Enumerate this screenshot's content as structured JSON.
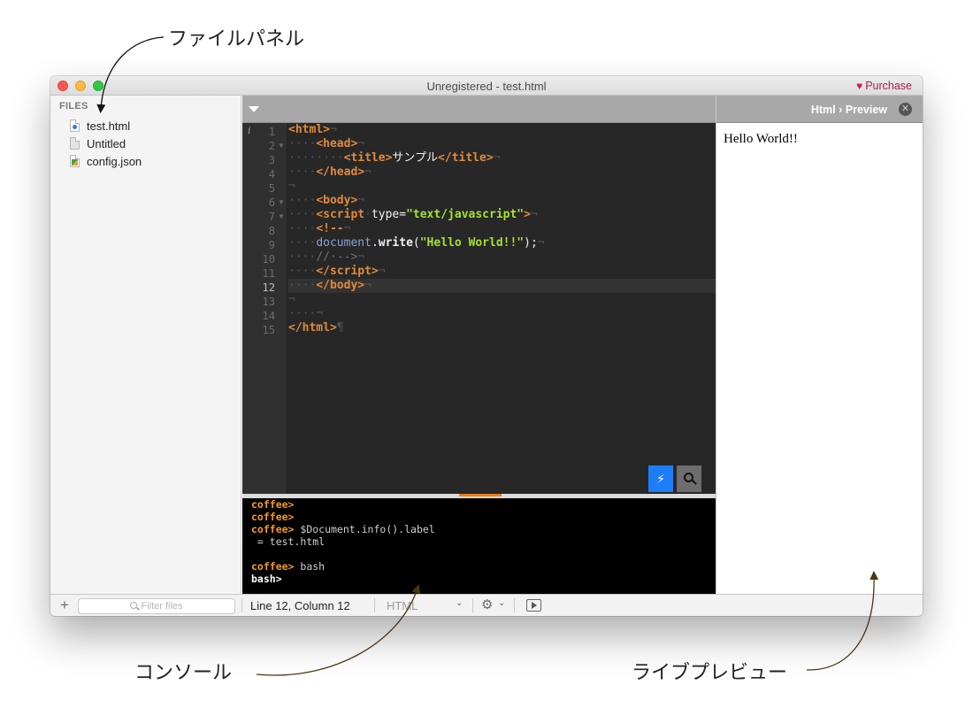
{
  "annotations": {
    "file_panel": "ファイルパネル",
    "console": "コンソール",
    "live_preview": "ライブプレビュー"
  },
  "window": {
    "title": "Unregistered - test.html",
    "purchase_label": "Purchase"
  },
  "sidebar": {
    "header": "FILES",
    "files": [
      {
        "name": "test.html",
        "icon": "html-file-icon"
      },
      {
        "name": "Untitled",
        "icon": "blank-file-icon"
      },
      {
        "name": "config.json",
        "icon": "json-file-icon"
      }
    ]
  },
  "editor": {
    "info_marker": "i",
    "line_numbers": [
      "1",
      "2",
      "3",
      "4",
      "5",
      "6",
      "7",
      "8",
      "9",
      "10",
      "11",
      "12",
      "13",
      "14",
      "15"
    ],
    "current_line": 12
  },
  "console": {
    "lines": [
      {
        "prompt": "coffee>",
        "text": ""
      },
      {
        "prompt": "coffee>",
        "text": ""
      },
      {
        "prompt": "coffee>",
        "text": " $Document.info().label"
      },
      {
        "prompt": "",
        "text": " = test.html"
      },
      {
        "prompt": "",
        "text": ""
      },
      {
        "prompt": "coffee>",
        "text": " bash"
      },
      {
        "prompt": "bash>",
        "text": ""
      }
    ]
  },
  "preview": {
    "title": "Html › Preview",
    "content": "Hello World!!"
  },
  "statusbar": {
    "filter_placeholder": "Filter files",
    "position": "Line 12, Column 12",
    "language": "HTML"
  },
  "colors": {
    "accent_blue": "#1e7ef7",
    "splitter_orange": "#f07d1a",
    "console_prompt": "#f79b1f",
    "purchase": "#b0204a"
  }
}
